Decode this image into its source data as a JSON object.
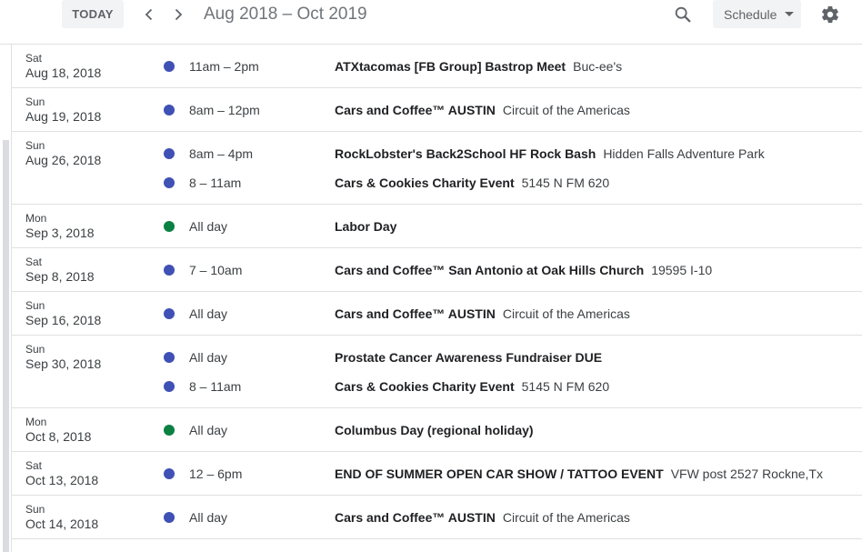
{
  "header": {
    "today_label": "TODAY",
    "date_range": "Aug 2018 – Oct 2019",
    "view_label": "Schedule",
    "icons": {
      "prev": "chevron-left-icon",
      "next": "chevron-right-icon",
      "search": "search-icon",
      "view": "caret-down-icon",
      "settings": "gear-icon"
    }
  },
  "colors": {
    "event_blue": "#3f51b5",
    "holiday_green": "#0b8043",
    "divider": "#e0e0e0"
  },
  "days": [
    {
      "dow": "Sat",
      "date": "Aug 18, 2018",
      "events": [
        {
          "time": "11am – 2pm",
          "title": "ATXtacomas [FB Group] Bastrop Meet",
          "location": "Buc-ee's",
          "color": "blue"
        }
      ]
    },
    {
      "dow": "Sun",
      "date": "Aug 19, 2018",
      "events": [
        {
          "time": "8am – 12pm",
          "title": "Cars and Coffee™ AUSTIN",
          "location": "Circuit of the Americas",
          "color": "blue"
        }
      ]
    },
    {
      "dow": "Sun",
      "date": "Aug 26, 2018",
      "events": [
        {
          "time": "8am – 4pm",
          "title": "RockLobster's Back2School HF Rock Bash",
          "location": "Hidden Falls Adventure Park",
          "color": "blue"
        },
        {
          "time": "8 – 11am",
          "title": "Cars & Cookies Charity Event",
          "location": "5145 N FM 620",
          "color": "blue"
        }
      ]
    },
    {
      "dow": "Mon",
      "date": "Sep 3, 2018",
      "events": [
        {
          "time": "All day",
          "title": "Labor Day",
          "location": "",
          "color": "green"
        }
      ]
    },
    {
      "dow": "Sat",
      "date": "Sep 8, 2018",
      "events": [
        {
          "time": "7 – 10am",
          "title": "Cars and Coffee™ San Antonio at Oak Hills Church",
          "location": "19595 I-10",
          "color": "blue"
        }
      ]
    },
    {
      "dow": "Sun",
      "date": "Sep 16, 2018",
      "events": [
        {
          "time": "All day",
          "title": "Cars and Coffee™ AUSTIN",
          "location": "Circuit of the Americas",
          "color": "blue"
        }
      ]
    },
    {
      "dow": "Sun",
      "date": "Sep 30, 2018",
      "events": [
        {
          "time": "All day",
          "title": "Prostate Cancer Awareness Fundraiser DUE",
          "location": "",
          "color": "blue"
        },
        {
          "time": "8 – 11am",
          "title": "Cars & Cookies Charity Event",
          "location": "5145 N FM 620",
          "color": "blue"
        }
      ]
    },
    {
      "dow": "Mon",
      "date": "Oct 8, 2018",
      "events": [
        {
          "time": "All day",
          "title": "Columbus Day (regional holiday)",
          "location": "",
          "color": "green"
        }
      ]
    },
    {
      "dow": "Sat",
      "date": "Oct 13, 2018",
      "events": [
        {
          "time": "12 – 6pm",
          "title": "END OF SUMMER OPEN CAR SHOW / TATTOO EVENT",
          "location": "VFW post 2527 Rockne,Tx",
          "color": "blue"
        }
      ]
    },
    {
      "dow": "Sun",
      "date": "Oct 14, 2018",
      "events": [
        {
          "time": "All day",
          "title": "Cars and Coffee™ AUSTIN",
          "location": "Circuit of the Americas",
          "color": "blue"
        }
      ]
    }
  ]
}
